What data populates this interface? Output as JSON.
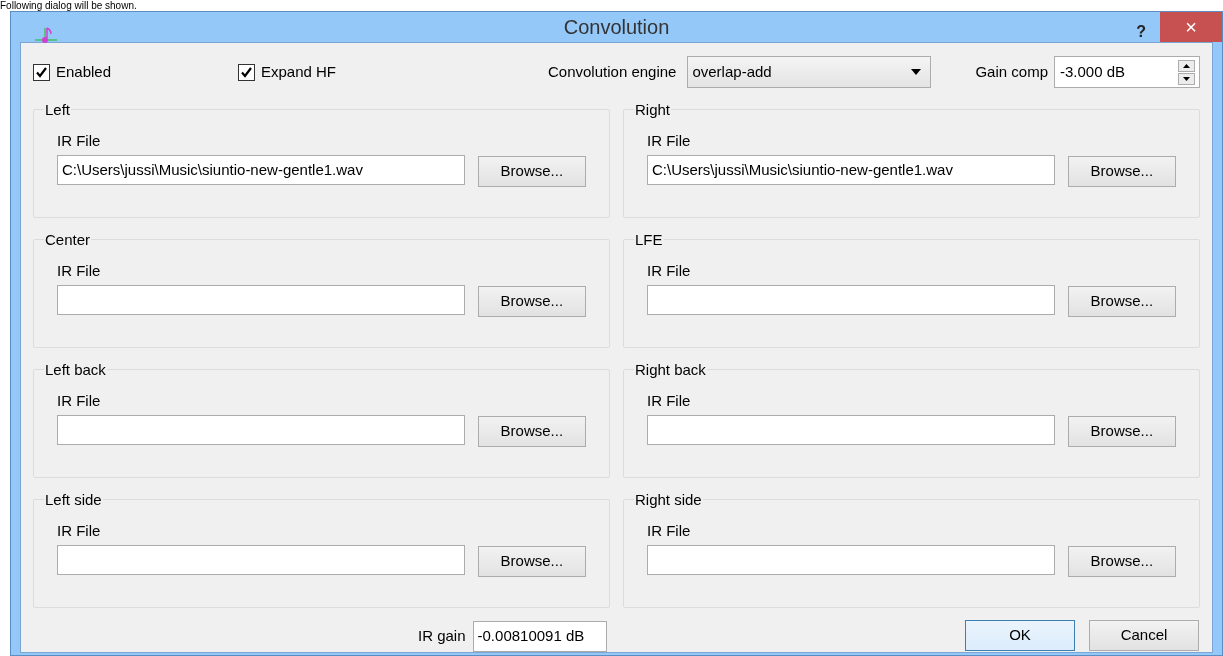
{
  "caption": "Following dialog will be shown.",
  "window": {
    "title": "Convolution",
    "help": "?",
    "close": "×"
  },
  "checkboxes": [
    {
      "label": "Enabled",
      "checked": true
    },
    {
      "label": "Expand HF",
      "checked": true
    }
  ],
  "engine": {
    "label": "Convolution engine",
    "value": "overlap-add"
  },
  "gain_comp": {
    "label": "Gain comp",
    "value": "-3.000 dB"
  },
  "channels": [
    {
      "name": "Left",
      "field_label": "IR File",
      "value": "C:\\Users\\jussi\\Music\\siuntio-new-gentle1.wav",
      "button": "Browse..."
    },
    {
      "name": "Right",
      "field_label": "IR File",
      "value": "C:\\Users\\jussi\\Music\\siuntio-new-gentle1.wav",
      "button": "Browse..."
    },
    {
      "name": "Center",
      "field_label": "IR File",
      "button": "Browse..."
    },
    {
      "name": "LFE",
      "field_label": "IR File",
      "button": "Browse..."
    },
    {
      "name": "Left back",
      "field_label": "IR File",
      "button": "Browse..."
    },
    {
      "name": "Right back",
      "field_label": "IR File",
      "button": "Browse..."
    },
    {
      "name": "Left side",
      "field_label": "IR File",
      "button": "Browse..."
    },
    {
      "name": "Right side",
      "field_label": "IR File",
      "button": "Browse..."
    }
  ],
  "ir_gain": {
    "label": "IR gain",
    "value": "-0.00810091 dB"
  },
  "buttons": [
    {
      "label": "OK",
      "default": true
    },
    {
      "label": "Cancel",
      "default": false
    }
  ]
}
